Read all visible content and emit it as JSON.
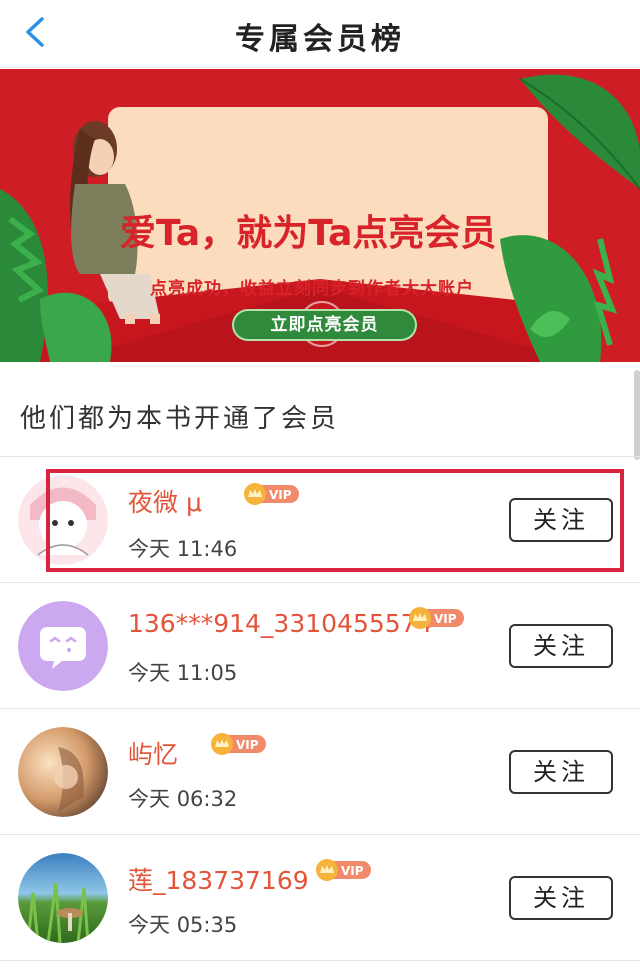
{
  "header": {
    "title": "专属会员榜",
    "back_icon": "chevron-left-icon"
  },
  "banner": {
    "title": "爱Ta，就为Ta点亮会员",
    "subtitle": "点亮成功，收益立刻同步到作者大大账户",
    "cta_label": "立即点亮会员"
  },
  "section": {
    "heading": "他们都为本书开通了会员"
  },
  "members": [
    {
      "name": "夜微 μ",
      "badge": "VIP",
      "date": "今天",
      "time": "11:46",
      "follow_label": "关注"
    },
    {
      "name": "136***914_3310455574",
      "badge": "VIP",
      "date": "今天",
      "time": "11:05",
      "follow_label": "关注"
    },
    {
      "name": "屿忆",
      "badge": "VIP",
      "date": "今天",
      "time": "06:32",
      "follow_label": "关注"
    },
    {
      "name": "莲_183737169",
      "badge": "VIP",
      "date": "今天",
      "time": "05:35",
      "follow_label": "关注"
    }
  ],
  "colors": {
    "banner_red": "#d8232a",
    "name_orange": "#e2553a",
    "accent_blue": "#2f8fe8",
    "highlight": "#d9243f"
  }
}
